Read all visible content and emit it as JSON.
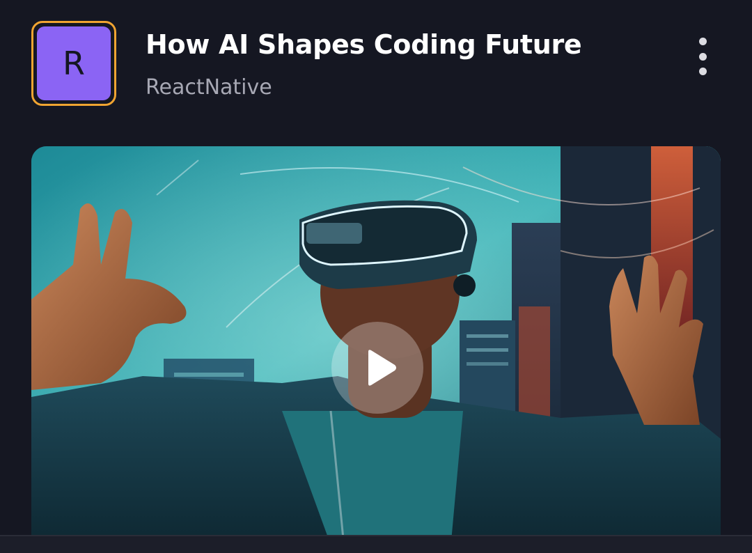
{
  "post": {
    "avatar_letter": "R",
    "title": "How AI Shapes Coding Future",
    "channel": "ReactNative"
  },
  "icons": {
    "more": "more-vertical-icon",
    "play": "play-icon"
  },
  "colors": {
    "background": "#151722",
    "avatar_fill": "#8B64F4",
    "avatar_border": "#F0A431",
    "title_text": "#FFFFFF",
    "channel_text": "#A7A8B4"
  }
}
